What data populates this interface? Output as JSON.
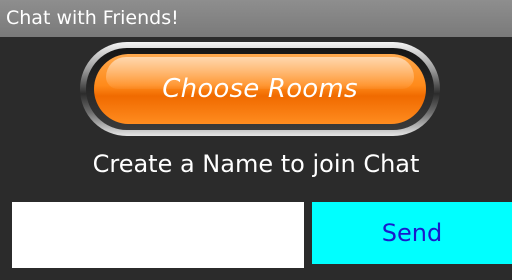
{
  "window": {
    "title": "Chat with Friends!"
  },
  "room_button": {
    "label": "Choose Rooms"
  },
  "prompt": {
    "text": "Create a Name to join Chat"
  },
  "name_input": {
    "value": "",
    "placeholder": ""
  },
  "send_button": {
    "label": "Send"
  },
  "colors": {
    "background": "#2b2b2b",
    "titlebar": "#858585",
    "room_button_orange": "#ff8a1a",
    "send_button_bg": "#00ffff",
    "send_button_text": "#1a1acc"
  }
}
